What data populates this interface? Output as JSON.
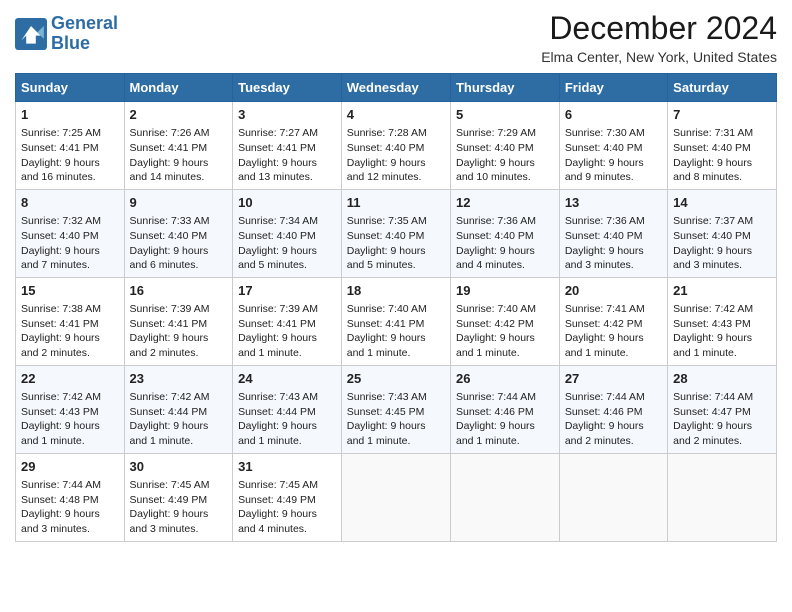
{
  "header": {
    "logo_line1": "General",
    "logo_line2": "Blue",
    "month_title": "December 2024",
    "location": "Elma Center, New York, United States"
  },
  "days_of_week": [
    "Sunday",
    "Monday",
    "Tuesday",
    "Wednesday",
    "Thursday",
    "Friday",
    "Saturday"
  ],
  "weeks": [
    [
      {
        "day": "1",
        "sunrise": "Sunrise: 7:25 AM",
        "sunset": "Sunset: 4:41 PM",
        "daylight": "Daylight: 9 hours and 16 minutes."
      },
      {
        "day": "2",
        "sunrise": "Sunrise: 7:26 AM",
        "sunset": "Sunset: 4:41 PM",
        "daylight": "Daylight: 9 hours and 14 minutes."
      },
      {
        "day": "3",
        "sunrise": "Sunrise: 7:27 AM",
        "sunset": "Sunset: 4:41 PM",
        "daylight": "Daylight: 9 hours and 13 minutes."
      },
      {
        "day": "4",
        "sunrise": "Sunrise: 7:28 AM",
        "sunset": "Sunset: 4:40 PM",
        "daylight": "Daylight: 9 hours and 12 minutes."
      },
      {
        "day": "5",
        "sunrise": "Sunrise: 7:29 AM",
        "sunset": "Sunset: 4:40 PM",
        "daylight": "Daylight: 9 hours and 10 minutes."
      },
      {
        "day": "6",
        "sunrise": "Sunrise: 7:30 AM",
        "sunset": "Sunset: 4:40 PM",
        "daylight": "Daylight: 9 hours and 9 minutes."
      },
      {
        "day": "7",
        "sunrise": "Sunrise: 7:31 AM",
        "sunset": "Sunset: 4:40 PM",
        "daylight": "Daylight: 9 hours and 8 minutes."
      }
    ],
    [
      {
        "day": "8",
        "sunrise": "Sunrise: 7:32 AM",
        "sunset": "Sunset: 4:40 PM",
        "daylight": "Daylight: 9 hours and 7 minutes."
      },
      {
        "day": "9",
        "sunrise": "Sunrise: 7:33 AM",
        "sunset": "Sunset: 4:40 PM",
        "daylight": "Daylight: 9 hours and 6 minutes."
      },
      {
        "day": "10",
        "sunrise": "Sunrise: 7:34 AM",
        "sunset": "Sunset: 4:40 PM",
        "daylight": "Daylight: 9 hours and 5 minutes."
      },
      {
        "day": "11",
        "sunrise": "Sunrise: 7:35 AM",
        "sunset": "Sunset: 4:40 PM",
        "daylight": "Daylight: 9 hours and 5 minutes."
      },
      {
        "day": "12",
        "sunrise": "Sunrise: 7:36 AM",
        "sunset": "Sunset: 4:40 PM",
        "daylight": "Daylight: 9 hours and 4 minutes."
      },
      {
        "day": "13",
        "sunrise": "Sunrise: 7:36 AM",
        "sunset": "Sunset: 4:40 PM",
        "daylight": "Daylight: 9 hours and 3 minutes."
      },
      {
        "day": "14",
        "sunrise": "Sunrise: 7:37 AM",
        "sunset": "Sunset: 4:40 PM",
        "daylight": "Daylight: 9 hours and 3 minutes."
      }
    ],
    [
      {
        "day": "15",
        "sunrise": "Sunrise: 7:38 AM",
        "sunset": "Sunset: 4:41 PM",
        "daylight": "Daylight: 9 hours and 2 minutes."
      },
      {
        "day": "16",
        "sunrise": "Sunrise: 7:39 AM",
        "sunset": "Sunset: 4:41 PM",
        "daylight": "Daylight: 9 hours and 2 minutes."
      },
      {
        "day": "17",
        "sunrise": "Sunrise: 7:39 AM",
        "sunset": "Sunset: 4:41 PM",
        "daylight": "Daylight: 9 hours and 1 minute."
      },
      {
        "day": "18",
        "sunrise": "Sunrise: 7:40 AM",
        "sunset": "Sunset: 4:41 PM",
        "daylight": "Daylight: 9 hours and 1 minute."
      },
      {
        "day": "19",
        "sunrise": "Sunrise: 7:40 AM",
        "sunset": "Sunset: 4:42 PM",
        "daylight": "Daylight: 9 hours and 1 minute."
      },
      {
        "day": "20",
        "sunrise": "Sunrise: 7:41 AM",
        "sunset": "Sunset: 4:42 PM",
        "daylight": "Daylight: 9 hours and 1 minute."
      },
      {
        "day": "21",
        "sunrise": "Sunrise: 7:42 AM",
        "sunset": "Sunset: 4:43 PM",
        "daylight": "Daylight: 9 hours and 1 minute."
      }
    ],
    [
      {
        "day": "22",
        "sunrise": "Sunrise: 7:42 AM",
        "sunset": "Sunset: 4:43 PM",
        "daylight": "Daylight: 9 hours and 1 minute."
      },
      {
        "day": "23",
        "sunrise": "Sunrise: 7:42 AM",
        "sunset": "Sunset: 4:44 PM",
        "daylight": "Daylight: 9 hours and 1 minute."
      },
      {
        "day": "24",
        "sunrise": "Sunrise: 7:43 AM",
        "sunset": "Sunset: 4:44 PM",
        "daylight": "Daylight: 9 hours and 1 minute."
      },
      {
        "day": "25",
        "sunrise": "Sunrise: 7:43 AM",
        "sunset": "Sunset: 4:45 PM",
        "daylight": "Daylight: 9 hours and 1 minute."
      },
      {
        "day": "26",
        "sunrise": "Sunrise: 7:44 AM",
        "sunset": "Sunset: 4:46 PM",
        "daylight": "Daylight: 9 hours and 1 minute."
      },
      {
        "day": "27",
        "sunrise": "Sunrise: 7:44 AM",
        "sunset": "Sunset: 4:46 PM",
        "daylight": "Daylight: 9 hours and 2 minutes."
      },
      {
        "day": "28",
        "sunrise": "Sunrise: 7:44 AM",
        "sunset": "Sunset: 4:47 PM",
        "daylight": "Daylight: 9 hours and 2 minutes."
      }
    ],
    [
      {
        "day": "29",
        "sunrise": "Sunrise: 7:44 AM",
        "sunset": "Sunset: 4:48 PM",
        "daylight": "Daylight: 9 hours and 3 minutes."
      },
      {
        "day": "30",
        "sunrise": "Sunrise: 7:45 AM",
        "sunset": "Sunset: 4:49 PM",
        "daylight": "Daylight: 9 hours and 3 minutes."
      },
      {
        "day": "31",
        "sunrise": "Sunrise: 7:45 AM",
        "sunset": "Sunset: 4:49 PM",
        "daylight": "Daylight: 9 hours and 4 minutes."
      },
      null,
      null,
      null,
      null
    ]
  ]
}
